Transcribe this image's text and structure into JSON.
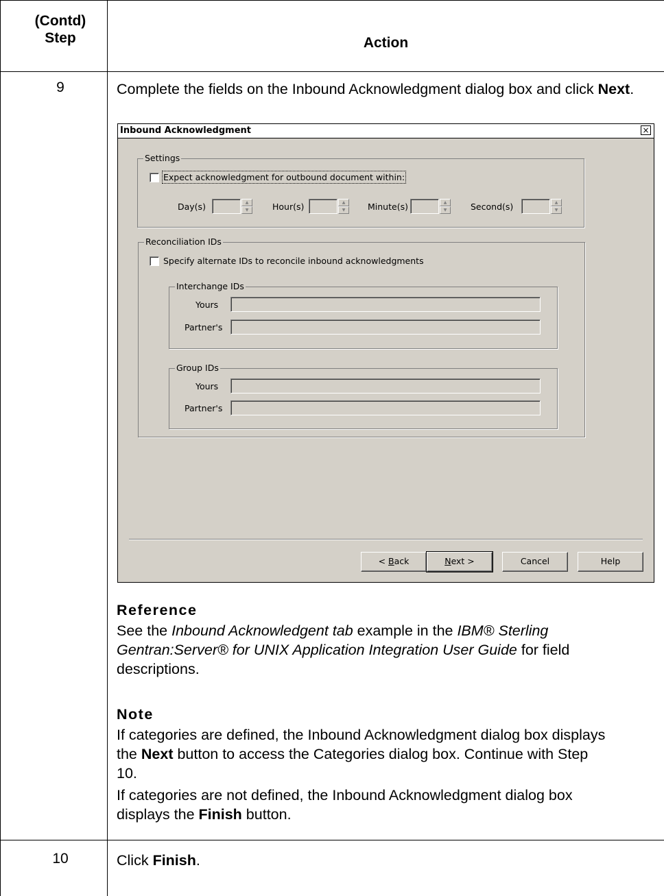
{
  "table": {
    "header_step_line1": "(Contd)",
    "header_step_line2": "Step",
    "header_action": "Action"
  },
  "step9": {
    "number": "9",
    "instruction_pre": "Complete the fields on the Inbound Acknowledgment dialog box and click ",
    "instruction_bold": "Next",
    "instruction_post": "."
  },
  "dialog": {
    "title": "Inbound Acknowledgment",
    "close_glyph": "×",
    "settings": {
      "group_label": "Settings",
      "checkbox_label": "Expect acknowledgment for outbound document within:",
      "days_label": "Day(s)",
      "hours_label": "Hour(s)",
      "minutes_label": "Minute(s)",
      "seconds_label": "Second(s)"
    },
    "reconciliation": {
      "group_label": "Reconciliation IDs",
      "checkbox_label": "Specify alternate IDs to reconcile inbound acknowledgments",
      "interchange": {
        "group_label": "Interchange IDs",
        "yours_label": "Yours",
        "partners_label": "Partner's"
      },
      "group_ids": {
        "group_label": "Group IDs",
        "yours_label": "Yours",
        "partners_label": "Partner's"
      }
    },
    "buttons": {
      "back_prefix": "< ",
      "back_u": "B",
      "back_rest": "ack",
      "next_u": "N",
      "next_rest": "ext >",
      "cancel": "Cancel",
      "help": "Help"
    }
  },
  "reference": {
    "heading": "Reference",
    "t1": "See the ",
    "t2": "Inbound Acknowledgent tab",
    "t3": " example in the ",
    "t4": "IBM® Sterling Gentran:Server® for UNIX Application Integration User Guide",
    "t5": " for field descriptions."
  },
  "note": {
    "heading": "Note",
    "p1_a": "If categories are defined, the Inbound Acknowledgment dialog box displays the ",
    "p1_b": "Next",
    "p1_c": " button to access the Categories dialog box. Continue with Step 10.",
    "p2_a": "If categories are not defined, the Inbound Acknowledgment dialog box displays the ",
    "p2_b": "Finish",
    "p2_c": " button."
  },
  "step10": {
    "number": "10",
    "text_a": "Click ",
    "text_b": "Finish",
    "text_c": "."
  }
}
